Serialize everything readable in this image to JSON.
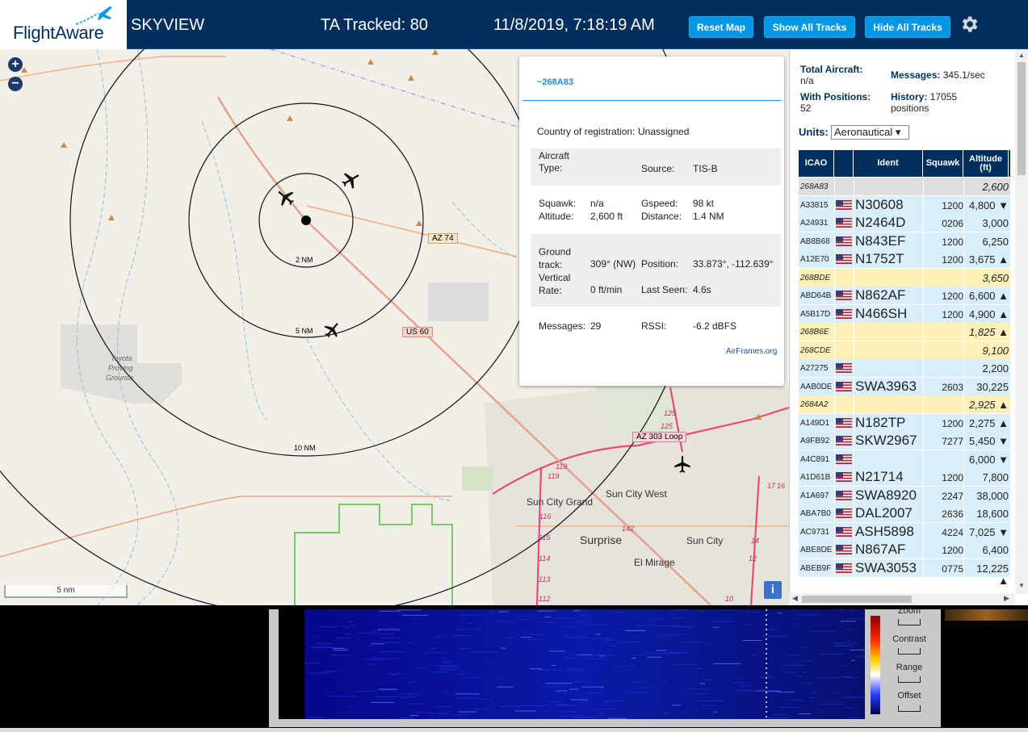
{
  "header": {
    "logo": "FlightAware",
    "site_name": "SKYVIEW",
    "tracked": "TA Tracked: 80",
    "datetime": "11/8/2019, 7:18:19 AM",
    "buttons": {
      "reset_map": "Reset Map",
      "show_all_tracks": "Show All Tracks",
      "hide_all_tracks": "Hide All Tracks"
    },
    "settings_icon": "gear-icon"
  },
  "map": {
    "zoom_in": "+",
    "zoom_out": "−",
    "scale_label": "5 nm",
    "range_rings": [
      "2 NM",
      "5 NM",
      "10 NM"
    ],
    "road_labels": [
      "AZ 74",
      "US 60",
      "AZ 303 Loop",
      "125",
      "125",
      "119",
      "119",
      "116",
      "115",
      "114",
      "113",
      "112",
      "142",
      "17",
      "16",
      "14",
      "12",
      "10"
    ],
    "place_labels": [
      "Toyota",
      "Proving",
      "Grounds",
      "Sun City West",
      "Sun City Grand",
      "Surprise",
      "Sun City",
      "El Mirage"
    ],
    "info_button": "i"
  },
  "popup": {
    "title": "~268A83",
    "country_label": "Country of registration:",
    "country_value": "Unassigned",
    "aircraft_type_label": "Aircraft Type:",
    "aircraft_type_value": "",
    "source_label": "Source:",
    "source_value": "TIS-B",
    "squawk_label": "Squawk:",
    "squawk_value": "n/a",
    "altitude_label": "Altitude:",
    "altitude_value": "2,600 ft",
    "gspeed_label": "Gspeed:",
    "gspeed_value": "98 kt",
    "distance_label": "Distance:",
    "distance_value": "1.4 NM",
    "ground_track_label": "Ground track:",
    "ground_track_value": "309° (NW)",
    "position_label": "Position:",
    "position_value": "33.873°, -112.639°",
    "vertical_rate_label": "Vertical Rate:",
    "vertical_rate_value": "0 ft/min",
    "last_seen_label": "Last Seen:",
    "last_seen_value": "4.6s",
    "messages_label": "Messages:",
    "messages_value": "29",
    "rssi_label": "RSSI:",
    "rssi_value": "-6.2 dBFS",
    "link": "AirFrames.org"
  },
  "sidebar": {
    "total_aircraft_label": "Total Aircraft:",
    "total_aircraft_value": "n/a",
    "messages_label": "Messages:",
    "messages_value": "345.1/sec",
    "with_positions_label": "With Positions:",
    "with_positions_value": "52",
    "history_label": "History:",
    "history_value": "17055 positions",
    "units_label": "Units:",
    "units_value": "Aeronautical ▾",
    "columns": [
      "ICAO",
      "",
      "Ident",
      "Squawk",
      "Altitude (ft)"
    ],
    "rows": [
      {
        "icao": "268A83",
        "flag": false,
        "ident": "",
        "squawk": "",
        "alt": "2,600",
        "style": "selected"
      },
      {
        "icao": "A33815",
        "flag": true,
        "ident": "N30608",
        "squawk": "1200",
        "alt": "4,800 ▼",
        "style": "normal"
      },
      {
        "icao": "A24931",
        "flag": true,
        "ident": "N2464D",
        "squawk": "0206",
        "alt": "3,000",
        "style": "normal"
      },
      {
        "icao": "AB8B68",
        "flag": true,
        "ident": "N843EF",
        "squawk": "1200",
        "alt": "6,250",
        "style": "normal"
      },
      {
        "icao": "A12E70",
        "flag": true,
        "ident": "N1752T",
        "squawk": "1200",
        "alt": "3,675 ▲",
        "style": "normal"
      },
      {
        "icao": "268BDE",
        "flag": false,
        "ident": "",
        "squawk": "",
        "alt": "3,650",
        "style": "tisb"
      },
      {
        "icao": "ABD64B",
        "flag": true,
        "ident": "N862AF",
        "squawk": "1200",
        "alt": "6,600 ▲",
        "style": "normal"
      },
      {
        "icao": "A5B17D",
        "flag": true,
        "ident": "N466SH",
        "squawk": "1200",
        "alt": "4,900 ▲",
        "style": "normal"
      },
      {
        "icao": "268B6E",
        "flag": false,
        "ident": "",
        "squawk": "",
        "alt": "1,825 ▲",
        "style": "tisb"
      },
      {
        "icao": "268CDE",
        "flag": false,
        "ident": "",
        "squawk": "",
        "alt": "9,100",
        "style": "tisb"
      },
      {
        "icao": "A27275",
        "flag": true,
        "ident": "",
        "squawk": "",
        "alt": "2,200",
        "style": "normal"
      },
      {
        "icao": "AAB0DE",
        "flag": true,
        "ident": "SWA3963",
        "squawk": "2603",
        "alt": "30,225 ▲",
        "style": "normal"
      },
      {
        "icao": "2684A2",
        "flag": false,
        "ident": "",
        "squawk": "",
        "alt": "2,925 ▲",
        "style": "tisb"
      },
      {
        "icao": "A149D1",
        "flag": true,
        "ident": "N182TP",
        "squawk": "1200",
        "alt": "2,275 ▲",
        "style": "normal"
      },
      {
        "icao": "A9FB92",
        "flag": true,
        "ident": "SKW2967",
        "squawk": "7277",
        "alt": "5,450 ▼",
        "style": "normal"
      },
      {
        "icao": "A4C891",
        "flag": true,
        "ident": "",
        "squawk": "",
        "alt": "6,000 ▼",
        "style": "normal"
      },
      {
        "icao": "A1D61B",
        "flag": true,
        "ident": "N21714",
        "squawk": "1200",
        "alt": "7,800",
        "style": "normal"
      },
      {
        "icao": "A1A697",
        "flag": true,
        "ident": "SWA8920",
        "squawk": "2247",
        "alt": "38,000",
        "style": "normal"
      },
      {
        "icao": "ABA7B0",
        "flag": true,
        "ident": "DAL2007",
        "squawk": "2636",
        "alt": "18,600 ▲",
        "style": "normal"
      },
      {
        "icao": "AC9731",
        "flag": true,
        "ident": "ASH5898",
        "squawk": "4224",
        "alt": "7,025 ▼",
        "style": "normal"
      },
      {
        "icao": "ABE8DE",
        "flag": true,
        "ident": "N867AF",
        "squawk": "1200",
        "alt": "6,400",
        "style": "normal"
      },
      {
        "icao": "ABEB9F",
        "flag": true,
        "ident": "SWA3053",
        "squawk": "0775",
        "alt": "12,225 ▲",
        "style": "normal"
      }
    ]
  },
  "waterfall": {
    "controls": [
      "Zoom",
      "Contrast",
      "Range",
      "Offset"
    ]
  },
  "colors": {
    "header_bg": "#002f5d",
    "button_bg": "#0097e6",
    "row_blue": "#d9eefb",
    "row_tisb": "#fdf0b8",
    "row_selected": "#dedede"
  }
}
